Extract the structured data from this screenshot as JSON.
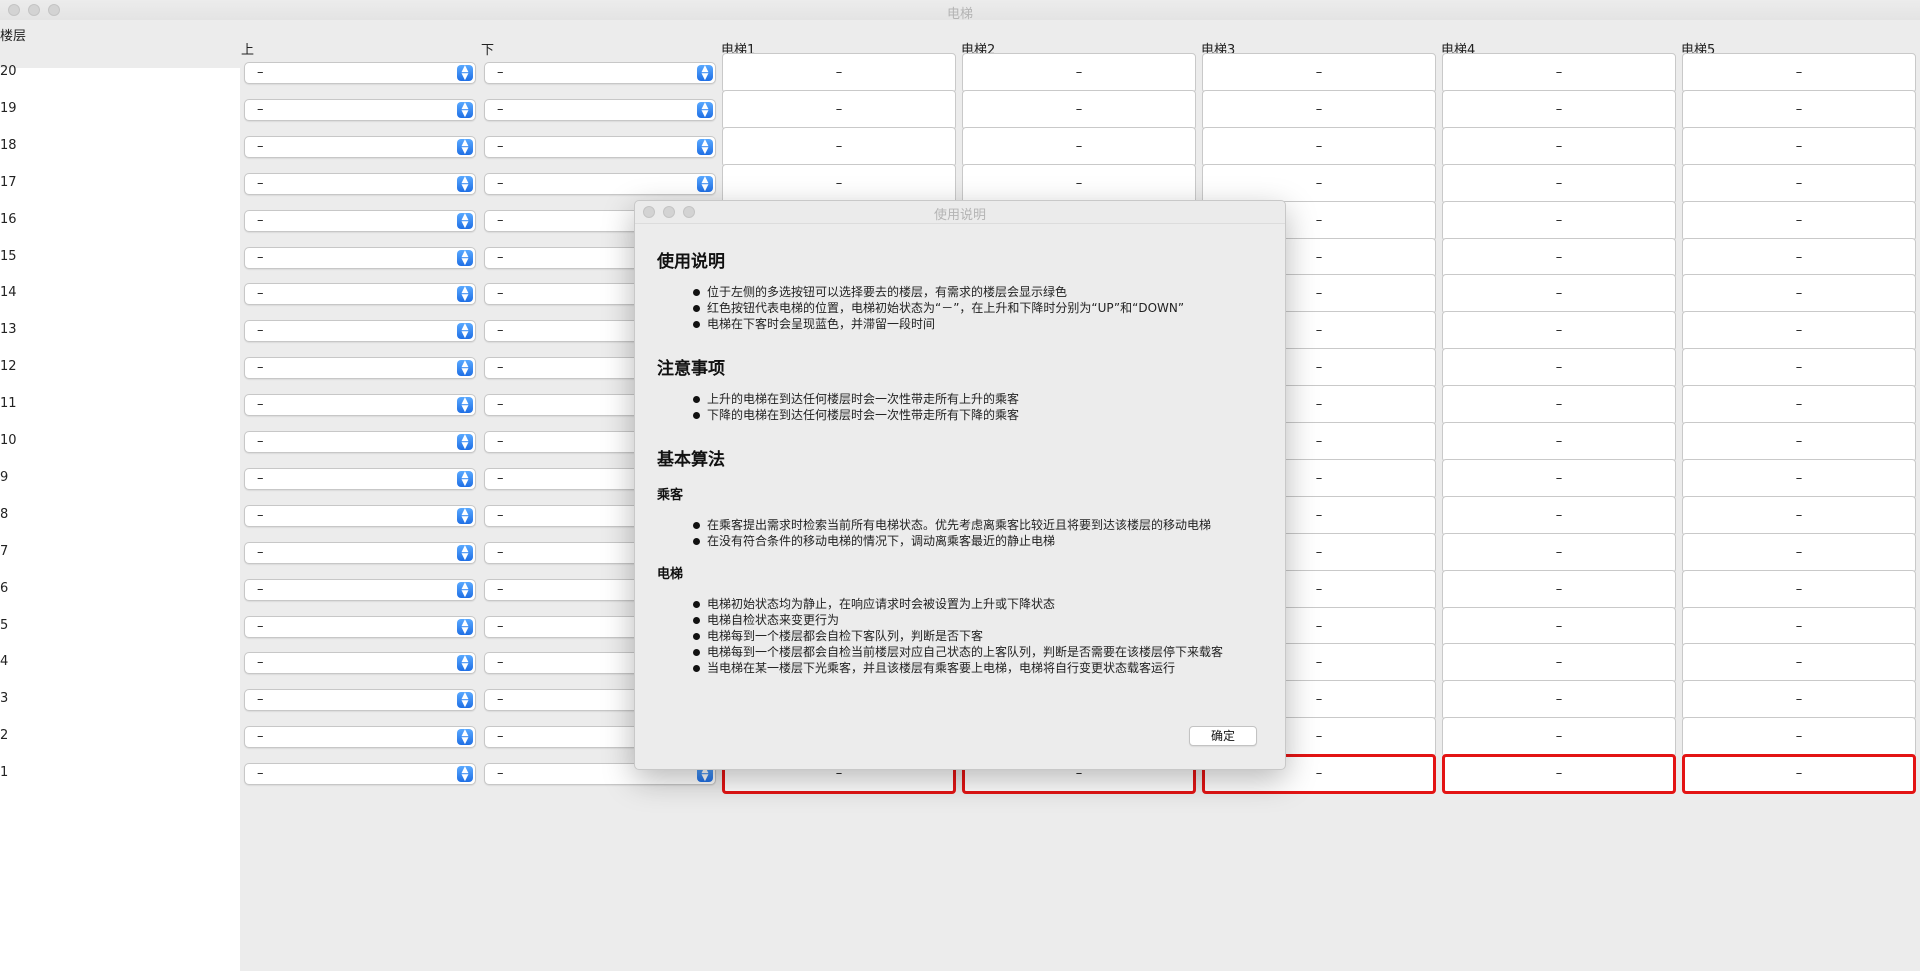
{
  "window": {
    "title": "电梯"
  },
  "headers": {
    "floor": "楼层",
    "up": "上",
    "down": "下",
    "elevators": [
      "电梯1",
      "电梯2",
      "电梯3",
      "电梯4",
      "电梯5"
    ]
  },
  "floors": [
    "20",
    "19",
    "18",
    "17",
    "16",
    "15",
    "14",
    "13",
    "12",
    "11",
    "10",
    "9",
    "8",
    "7",
    "6",
    "5",
    "4",
    "3",
    "2",
    "1"
  ],
  "combo_value": "–",
  "cell_value": "–",
  "elevator_position_floor": "1",
  "colors": {
    "elevator_position_border": "#e31414",
    "combo_arrow": "#1f6fe5"
  },
  "dialog": {
    "title": "使用说明",
    "sections": [
      {
        "heading": "使用说明",
        "items": [
          "位于左侧的多选按钮可以选择要去的楼层，有需求的楼层会显示绿色",
          "红色按钮代表电梯的位置，电梯初始状态为“－”，在上升和下降时分别为“UP”和“DOWN”",
          "电梯在下客时会呈现蓝色，并滞留一段时间"
        ]
      },
      {
        "heading": "注意事项",
        "items": [
          "上升的电梯在到达任何楼层时会一次性带走所有上升的乘客",
          "下降的电梯在到达任何楼层时会一次性带走所有下降的乘客"
        ]
      },
      {
        "heading": "基本算法",
        "subsections": [
          {
            "heading": "乘客",
            "items": [
              "在乘客提出需求时检索当前所有电梯状态。优先考虑离乘客比较近且将要到达该楼层的移动电梯",
              "在没有符合条件的移动电梯的情况下，调动离乘客最近的静止电梯"
            ]
          },
          {
            "heading": "电梯",
            "items": [
              "电梯初始状态均为静止，在响应请求时会被设置为上升或下降状态",
              "电梯自检状态来变更行为",
              "电梯每到一个楼层都会自检下客队列，判断是否下客",
              "电梯每到一个楼层都会自检当前楼层对应自己状态的上客队列，判断是否需要在该楼层停下来载客",
              "当电梯在某一楼层下光乘客，并且该楼层有乘客要上电梯，电梯将自行变更状态载客运行"
            ]
          }
        ]
      }
    ],
    "ok_label": "确定"
  }
}
